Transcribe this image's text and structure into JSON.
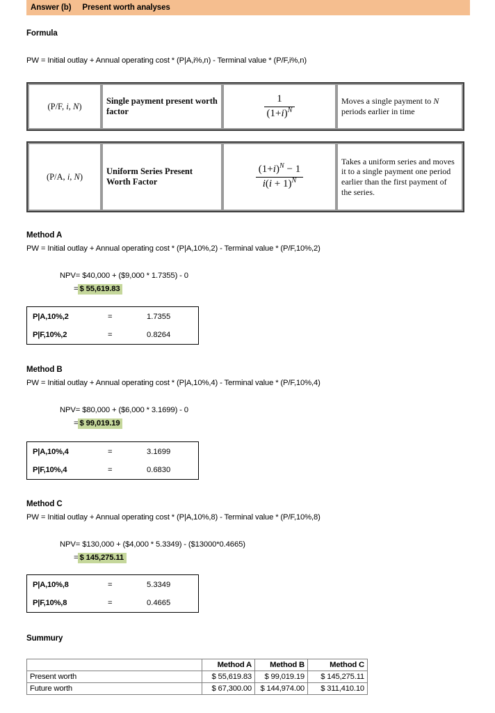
{
  "banner": {
    "label": "Answer (b)",
    "title": "Present worth analyses",
    "bg_color": "#F5BE8F"
  },
  "formula_section": {
    "heading": "Formula",
    "equation": "PW = Initial outlay  + Annual operating cost * (P|A,i%,n) - Terminal value  * (P/F,i%,n)"
  },
  "factor_table": {
    "rows": [
      {
        "code": "(P/F, i, N)",
        "name": "Single payment present worth factor",
        "formula_numerator": "1",
        "formula_denominator": "(1+i)",
        "formula_exponent": "N",
        "description": "Moves a single payment to N periods earlier in time"
      },
      {
        "code": "(P/A, i, N)",
        "name": "Uniform Series Present Worth Factor",
        "formula_numerator": "(1+i)",
        "formula_numerator_exp": "N",
        "formula_numerator_tail": "− 1",
        "formula_denominator": "i(i + 1)",
        "formula_denominator_exp": "N",
        "description": "Takes a uniform series and moves it to a single payment one period earlier than the first payment of the series."
      }
    ]
  },
  "methods": [
    {
      "heading": "Method A",
      "equation": "PW = Initial outlay  + Annual operating cost * (P|A,10%,2) - Terminal value  * (P/F,10%,2)",
      "npv_line": "NPV= $40,000 + ($9,000 * 1.7355) - 0",
      "result_prefix": "=",
      "result": "$ 55,619.83",
      "factors": [
        {
          "key": "P|A,10%,2",
          "eq": "=",
          "value": "1.7355"
        },
        {
          "key": "P|F,10%,2",
          "eq": "=",
          "value": "0.8264"
        }
      ]
    },
    {
      "heading": "Method B",
      "equation": "PW = Initial outlay  + Annual operating cost * (P|A,10%,4) - Terminal value  * (P/F,10%,4)",
      "npv_line": "NPV= $80,000 + ($6,000 * 3.1699) - 0",
      "result_prefix": "=",
      "result": "$ 99,019.19",
      "factors": [
        {
          "key": "P|A,10%,4",
          "eq": "=",
          "value": "3.1699"
        },
        {
          "key": "P|F,10%,4",
          "eq": "=",
          "value": "0.6830"
        }
      ]
    },
    {
      "heading": "Method C",
      "equation": "PW = Initial outlay  + Annual operating cost * (P|A,10%,8) - Terminal value  * (P/F,10%,8)",
      "npv_line": "NPV= $130,000 + ($4,000 * 5.3349) - ($13000*0.4665)",
      "result_prefix": "=",
      "result": "$ 145,275.11",
      "factors": [
        {
          "key": "P|A,10%,8",
          "eq": "=",
          "value": "5.3349"
        },
        {
          "key": "P|F,10%,8",
          "eq": "=",
          "value": "0.4665"
        }
      ]
    }
  ],
  "summary": {
    "heading": "Summury",
    "columns": [
      "",
      "Method A",
      "Method B",
      "Method C"
    ],
    "rows": [
      {
        "label": "Present worth",
        "values": [
          "$ 55,619.83",
          "$ 99,019.19",
          "$ 145,275.11"
        ]
      },
      {
        "label": "Future worth",
        "values": [
          "$ 67,300.00",
          "$ 144,974.00",
          "$ 311,410.10"
        ]
      }
    ]
  },
  "colors": {
    "banner": "#F5BE8F",
    "highlight": "#C5D79B"
  }
}
